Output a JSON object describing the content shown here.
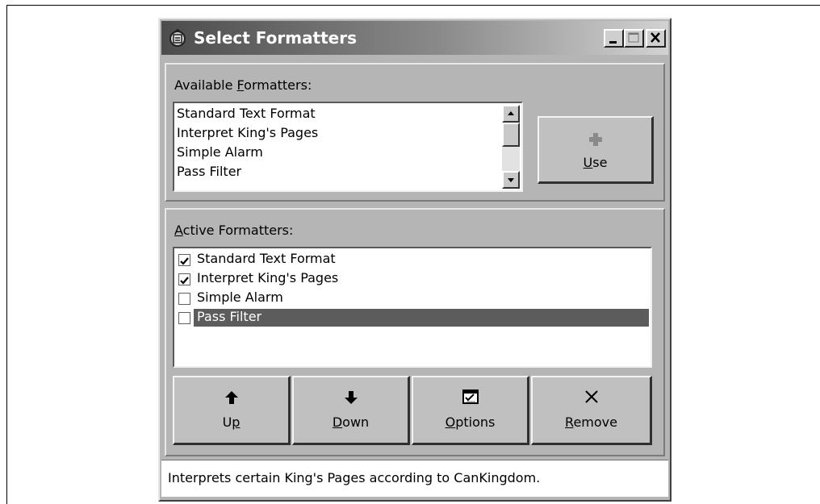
{
  "window": {
    "title": "Select Formatters",
    "controls": [
      "minimize-icon",
      "maximize-icon",
      "close-icon"
    ]
  },
  "available": {
    "label_pre": "Available ",
    "label_accel": "F",
    "label_post": "ormatters:",
    "items": [
      "Standard Text Format",
      "Interpret King's Pages",
      "Simple Alarm",
      "Pass Filter"
    ],
    "use_button": {
      "accel": "U",
      "rest": "se",
      "icon": "plus-icon"
    }
  },
  "active": {
    "label_accel": "A",
    "label_post": "ctive Formatters:",
    "items": [
      {
        "label": "Standard Text Format",
        "checked": true
      },
      {
        "label": "Interpret King's Pages",
        "checked": true
      },
      {
        "label": "Simple Alarm",
        "checked": false
      },
      {
        "label": "Pass Filter",
        "checked": false,
        "selected": true
      }
    ]
  },
  "buttons": {
    "up": {
      "pre": "U",
      "accel": "p",
      "post": "",
      "icon": "arrow-up-icon"
    },
    "down": {
      "pre": "",
      "accel": "D",
      "post": "own",
      "icon": "arrow-down-icon"
    },
    "options": {
      "pre": "",
      "accel": "O",
      "post": "ptions",
      "icon": "options-icon"
    },
    "remove": {
      "pre": "",
      "accel": "R",
      "post": "emove",
      "icon": "remove-x-icon"
    }
  },
  "status": {
    "text": "Interprets certain King's Pages according to CanKingdom."
  },
  "colors": {
    "dialog_face": "#b5b5b5",
    "selection": "#5c5c5c",
    "title_gradient_start": "#4c4c4c",
    "title_gradient_end": "#d2d2d2"
  }
}
